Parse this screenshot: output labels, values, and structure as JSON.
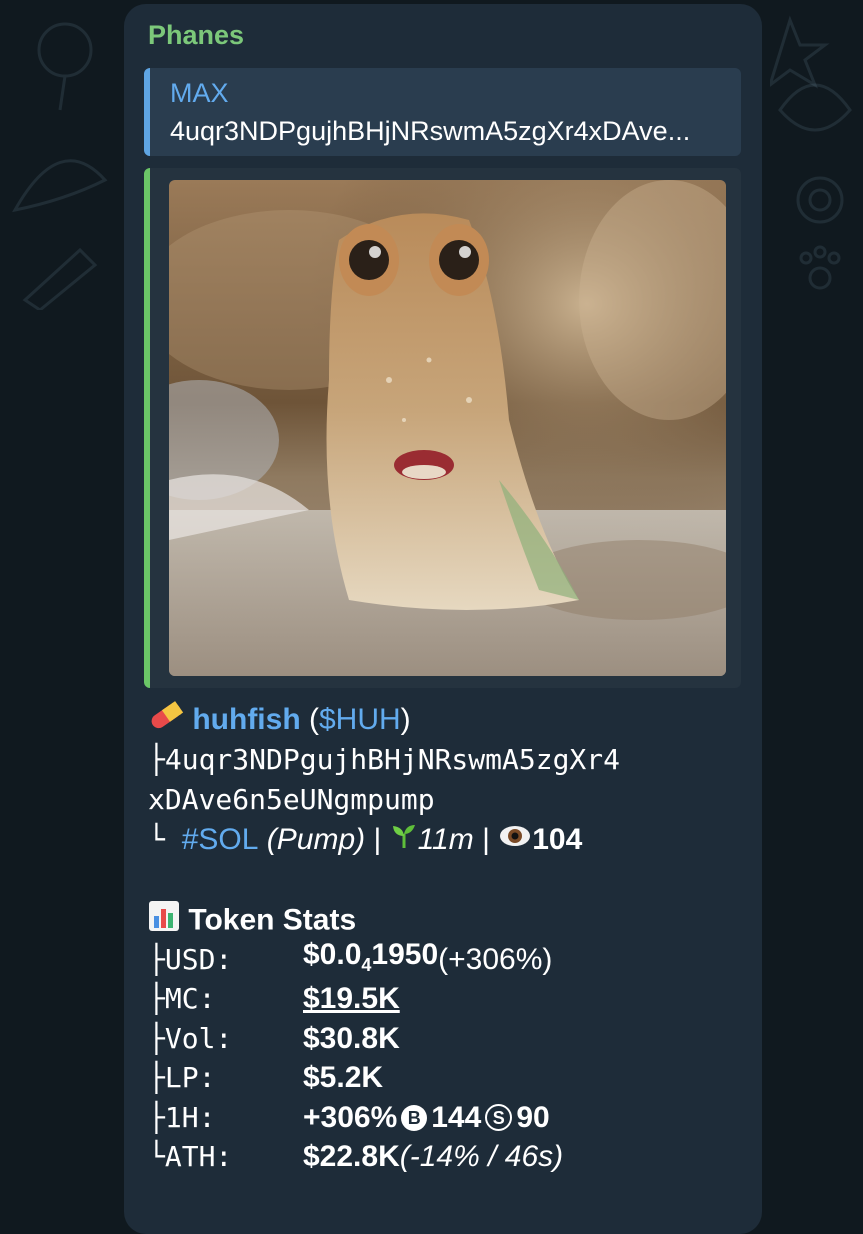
{
  "message": {
    "sender": "Phanes",
    "reply": {
      "name": "MAX",
      "text": "4uqr3NDPgujhBHjNRswmA5zgXr4xDAve..."
    },
    "token": {
      "name": "huhfish",
      "ticker_open": " (",
      "ticker": "$HUH",
      "ticker_close": ")",
      "address_line1": "├4uqr3NDPgujhBHjNRswmA5zgXr4",
      "address_line2": "xDAve6n5eUNgmpump",
      "chain_prefix": "└ ",
      "chain_tag": "#SOL",
      "platform": " (Pump)",
      "sep1": " | ",
      "age": "11m",
      "sep2": " | ",
      "views": "104"
    },
    "stats": {
      "title": "Token Stats",
      "rows": [
        {
          "label": "├USD:",
          "value_prefix": "$0.0",
          "value_sub": "4",
          "value_suffix": "1950",
          "extra": " (+306%)"
        },
        {
          "label": "├MC:",
          "value": "$19.5K"
        },
        {
          "label": "├Vol:",
          "value": "$30.8K"
        },
        {
          "label": "├LP:",
          "value": "$5.2K"
        },
        {
          "label": "├1H:",
          "value": "+306%",
          "buy_badge": "B",
          "buys": "144",
          "sell_badge": "S",
          "sells": "90"
        },
        {
          "label": "└ATH:",
          "value": "$22.8K",
          "extra": " (-14% / 46s)"
        }
      ]
    }
  },
  "icons": {
    "pill": "pill-icon",
    "seedling": "seedling-icon",
    "eye": "eye-icon",
    "chart": "bar-chart-icon"
  },
  "colors": {
    "sender": "#7cc87a",
    "link": "#62abee",
    "bubble": "#1e2c39",
    "background": "#10191f"
  }
}
